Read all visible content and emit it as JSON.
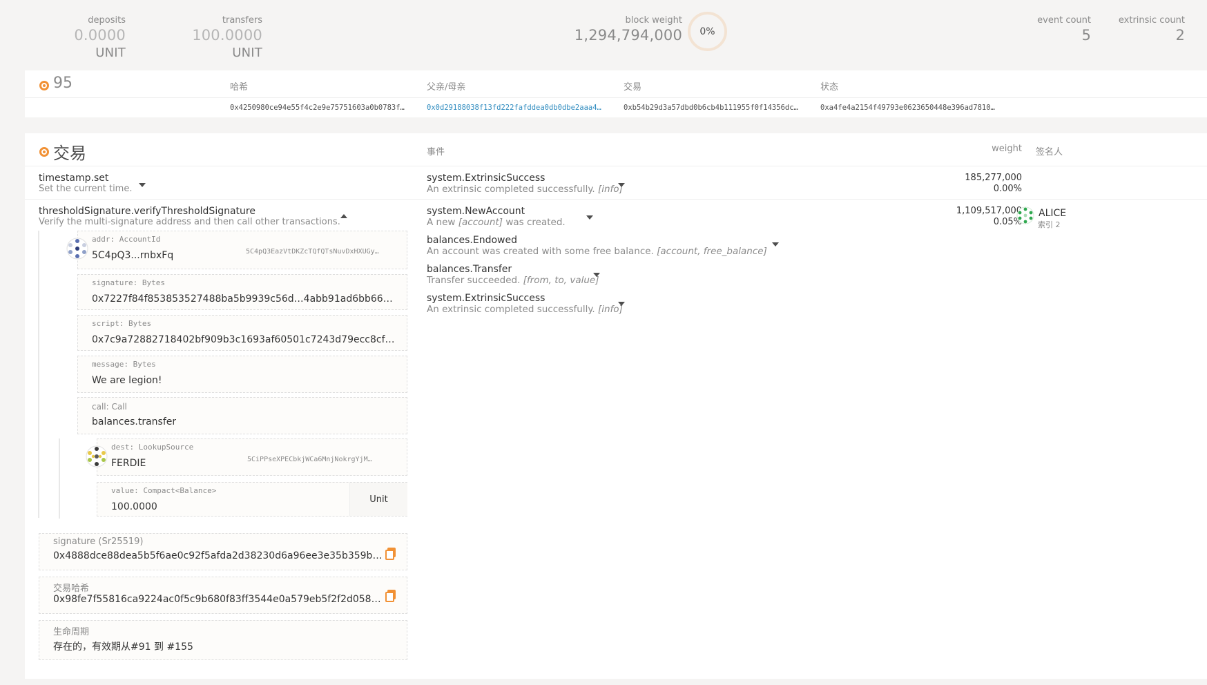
{
  "summary": {
    "deposits": {
      "label": "deposits",
      "lead": "0.",
      "value": "0000",
      "unit": "UNIT"
    },
    "transfers": {
      "label": "transfers",
      "lead": "100.",
      "value": "0000",
      "unit": "UNIT"
    },
    "block_weight": {
      "label": "block weight",
      "value": "1,294,794,000",
      "percent": "0%"
    },
    "event_count": {
      "label": "event count",
      "value": "5"
    },
    "extrinsic_count": {
      "label": "extrinsic count",
      "value": "2"
    }
  },
  "block": {
    "number": "95",
    "headers": {
      "hash": "哈希",
      "parent": "父亲/母亲",
      "extrinsics": "交易",
      "state": "状态"
    },
    "hash": "0x4250980ce94e55f4c2e9e75751603a0b0783f…",
    "parent": "0x0d29188038f13fd222fafddea0db0dbe2aaa4…",
    "extrinsics_root": "0xb54b29d3a57dbd0b6cb4b111955f0f14356dc…",
    "state_root": "0xa4fe4a2154f49793e0623650448e396ad7810…"
  },
  "extrinsics": {
    "title": "交易",
    "headers": {
      "events": "事件",
      "weight": "weight",
      "signer": "签名人"
    },
    "rows": [
      {
        "call": "timestamp.set",
        "desc": "Set the current time.",
        "events": [
          {
            "name": "system.ExtrinsicSuccess",
            "desc": "An extrinsic completed successfully.",
            "args": "[info]"
          }
        ],
        "weight": "185,277,000",
        "weight_pct": "0.00%"
      },
      {
        "call": "thresholdSignature.verifyThresholdSignature",
        "desc": "Verify the multi-signature address and then call other transactions.",
        "events": [
          {
            "name": "system.NewAccount",
            "desc_pre": "A new",
            "args": "[account]",
            "desc_post": "was created."
          },
          {
            "name": "balances.Endowed",
            "desc": "An account was created with some free balance.",
            "args": "[account, free_balance]"
          },
          {
            "name": "balances.Transfer",
            "desc": "Transfer succeeded.",
            "args": "[from, to, value]"
          },
          {
            "name": "system.ExtrinsicSuccess",
            "desc": "An extrinsic completed successfully.",
            "args": "[info]"
          }
        ],
        "weight": "1,109,517,000",
        "weight_pct": "0.05%",
        "signer": {
          "name": "ALICE",
          "index": "索引 2"
        },
        "params": {
          "addr": {
            "label": "addr: AccountId",
            "value": "5C4pQ3...rnbxFq",
            "full": "5C4pQ3EazVtDKZcTQfQTsNuvDxHXUGy…"
          },
          "signature": {
            "label": "signature: Bytes",
            "value": "0x7227f84f853853527488ba5b9939c56d…4abb91ad6bb66677a0f…"
          },
          "script": {
            "label": "script: Bytes",
            "value": "0x7c9a72882718402bf909b3c1693af60501c7243d79ecc8cf030fa2…"
          },
          "message": {
            "label": "message: Bytes",
            "value": "We are legion!"
          },
          "call": {
            "label": "call: Call",
            "value": "balances.transfer"
          },
          "dest": {
            "label": "dest: LookupSource",
            "value": "FERDIE",
            "full": "5CiPPseXPECbkjWCa6MnjNokrgYjM…"
          },
          "amount": {
            "label": "value: Compact<Balance>",
            "value": "100.0000",
            "unit": "Unit"
          }
        },
        "signature_box": {
          "label": "signature (Sr25519)",
          "value": "0x4888dce88dea5b5f6ae0c92f5afda2d38230d6a96ee3e35b359b53e237…"
        },
        "tx_hash_box": {
          "label": "交易哈希",
          "value": "0x98fe7f55816ca9224ac0f5c9b680f83ff3544e0a579eb5f2f2d05813af63c…"
        },
        "lifetime_box": {
          "label": "生命周期",
          "value": "存在的，有效期从#91 到 #155"
        }
      }
    ]
  },
  "colors": {
    "accent": "#f19135",
    "link": "#2e8bbf"
  }
}
